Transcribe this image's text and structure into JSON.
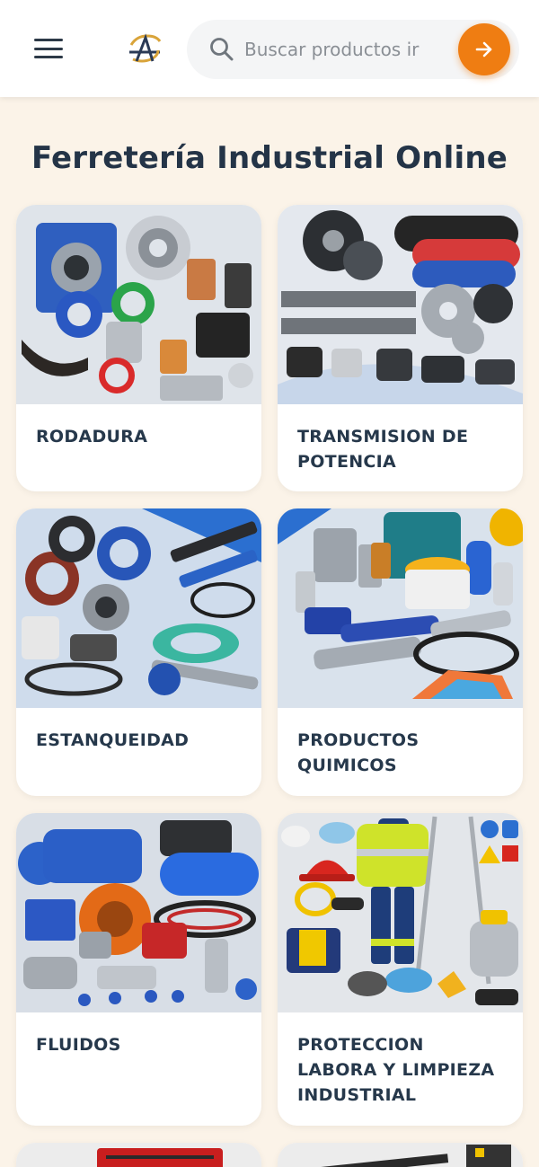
{
  "header": {
    "search_placeholder": "Buscar productos ir"
  },
  "page_title": "Ferretería Industrial Online",
  "categories": [
    {
      "label": "RODADURA",
      "icon": "bearing-icon"
    },
    {
      "label": "TRANSMISION DE POTENCIA",
      "icon": "gear-chain-icon"
    },
    {
      "label": "ESTANQUEIDAD",
      "icon": "seal-ring-icon"
    },
    {
      "label": "PRODUCTOS QUIMICOS",
      "icon": "chemical-drum-icon"
    },
    {
      "label": "FLUIDOS",
      "icon": "pump-valve-icon"
    },
    {
      "label": "PROTECCION LABORA Y LIMPIEZA INDUSTRIAL",
      "icon": "safety-helmet-icon"
    }
  ],
  "colors": {
    "accent": "#ef7d12",
    "background": "#fbf3e8",
    "text": "#243447"
  }
}
